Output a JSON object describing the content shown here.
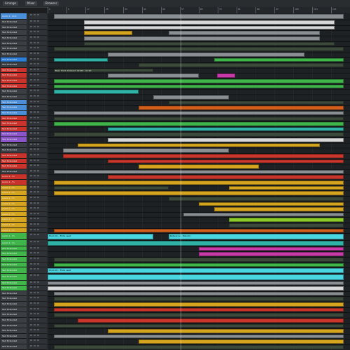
{
  "window": {
    "tabs": [
      "Arrange",
      "Mixer",
      "Browser"
    ]
  },
  "ruler": {
    "bars": [
      "1",
      "9",
      "17",
      "25",
      "33",
      "41",
      "49",
      "57",
      "65",
      "73",
      "81",
      "89",
      "97",
      "105",
      "113",
      "121"
    ]
  },
  "colors": {
    "green": "#3fb54a",
    "lime": "#8ccc2a",
    "yellow": "#d6a520",
    "orange": "#d2601c",
    "red": "#c8362c",
    "magenta": "#c83aa8",
    "purple": "#8a55c8",
    "teal": "#2fb3a6",
    "cyan": "#4ad6e0",
    "grey": "#8a8f94",
    "white": "#d8d8d8",
    "dark": "#3c4a3c"
  },
  "tracks": [
    {
      "name": "Audio 1 - Kick",
      "color": "#4b8fd8",
      "height": 6,
      "clips": [
        {
          "s": 0.02,
          "e": 0.98,
          "c": "grey",
          "l": ""
        }
      ]
    },
    {
      "name": "Text Extended",
      "color": "#3b3f44",
      "height": 5,
      "clips": [
        {
          "s": 0.12,
          "e": 0.95,
          "c": "white",
          "l": ""
        }
      ]
    },
    {
      "name": "Text Extended",
      "color": "#3b3f44",
      "height": 5,
      "clips": [
        {
          "s": 0.12,
          "e": 0.95,
          "c": "white",
          "l": ""
        }
      ]
    },
    {
      "name": "Text Extended",
      "color": "#3b3f44",
      "height": 5,
      "clips": [
        {
          "s": 0.12,
          "e": 0.28,
          "c": "yellow",
          "l": ""
        },
        {
          "s": 0.4,
          "e": 0.9,
          "c": "grey",
          "l": ""
        }
      ]
    },
    {
      "name": "Text Extended",
      "color": "#3b3f44",
      "height": 5,
      "clips": [
        {
          "s": 0.12,
          "e": 0.9,
          "c": "grey",
          "l": ""
        }
      ]
    },
    {
      "name": "Text Extended",
      "color": "#3b3f44",
      "height": 5,
      "clips": [
        {
          "s": 0.12,
          "e": 0.95,
          "c": "dark",
          "l": ""
        }
      ]
    },
    {
      "name": "Text Extended",
      "color": "#3b3f44",
      "height": 5,
      "clips": [
        {
          "s": 0.02,
          "e": 0.98,
          "c": "dark",
          "l": ""
        }
      ]
    },
    {
      "name": "Text Extended",
      "color": "#3b3f44",
      "height": 5,
      "clips": [
        {
          "s": 0.2,
          "e": 0.85,
          "c": "grey",
          "l": ""
        }
      ]
    },
    {
      "name": "Text Extended",
      "color": "#2c7ed6",
      "height": 5,
      "clips": [
        {
          "s": 0.02,
          "e": 0.2,
          "c": "teal",
          "l": ""
        },
        {
          "s": 0.55,
          "e": 0.98,
          "c": "green",
          "l": ""
        }
      ]
    },
    {
      "name": "Text Extended",
      "color": "#3b3f44",
      "height": 5,
      "clips": [
        {
          "s": 0.3,
          "e": 0.98,
          "c": "dark",
          "l": ""
        }
      ]
    },
    {
      "name": "Text Extended",
      "color": "#c9332b",
      "height": 5,
      "clips": [
        {
          "s": 0.02,
          "e": 0.35,
          "c": "dark",
          "l": "Bass_Hold_Ambient_A2016 - Kickit"
        }
      ]
    },
    {
      "name": "Text Extended",
      "color": "#c9332b",
      "height": 5,
      "clips": [
        {
          "s": 0.2,
          "e": 0.5,
          "c": "grey",
          "l": ""
        },
        {
          "s": 0.56,
          "e": 0.62,
          "c": "magenta",
          "l": ""
        }
      ]
    },
    {
      "name": "Text Extended",
      "color": "#c9332b",
      "height": 5,
      "clips": [
        {
          "s": 0.02,
          "e": 0.98,
          "c": "green",
          "l": ""
        }
      ]
    },
    {
      "name": "Text Extended",
      "color": "#c9332b",
      "height": 5,
      "clips": [
        {
          "s": 0.02,
          "e": 0.98,
          "c": "green",
          "l": ""
        }
      ]
    },
    {
      "name": "Text Extended",
      "color": "#3b3f44",
      "height": 5,
      "clips": [
        {
          "s": 0.02,
          "e": 0.3,
          "c": "teal",
          "l": ""
        }
      ]
    },
    {
      "name": "Text Extended",
      "color": "#3b3f44",
      "height": 5,
      "clips": [
        {
          "s": 0.35,
          "e": 0.6,
          "c": "grey",
          "l": ""
        }
      ]
    },
    {
      "name": "Text Extended",
      "color": "#4b8fd8",
      "height": 5,
      "clips": [
        {
          "s": 0.4,
          "e": 0.98,
          "c": "dark",
          "l": ""
        }
      ]
    },
    {
      "name": "Text Extended",
      "color": "#4b8fd8",
      "height": 5,
      "clips": [
        {
          "s": 0.3,
          "e": 0.98,
          "c": "orange",
          "l": ""
        }
      ]
    },
    {
      "name": "Text Extended",
      "color": "#4b8fd8",
      "height": 5,
      "clips": [
        {
          "s": 0.02,
          "e": 0.98,
          "c": "grey",
          "l": ""
        }
      ]
    },
    {
      "name": "Text Extended",
      "color": "#c9332b",
      "height": 5,
      "clips": [
        {
          "s": 0.02,
          "e": 0.98,
          "c": "dark",
          "l": ""
        }
      ]
    },
    {
      "name": "Text Extended",
      "color": "#c9332b",
      "height": 5,
      "clips": [
        {
          "s": 0.02,
          "e": 0.98,
          "c": "green",
          "l": ""
        }
      ]
    },
    {
      "name": "Text Extended",
      "color": "#c9332b",
      "height": 5,
      "clips": [
        {
          "s": 0.2,
          "e": 0.98,
          "c": "teal",
          "l": ""
        }
      ]
    },
    {
      "name": "Text Extended",
      "color": "#8a55c8",
      "height": 5,
      "clips": [
        {
          "s": 0.02,
          "e": 0.98,
          "c": "dark",
          "l": ""
        }
      ]
    },
    {
      "name": "Text Extended",
      "color": "#8a55c8",
      "height": 5,
      "clips": [
        {
          "s": 0.2,
          "e": 0.98,
          "c": "white",
          "l": ""
        }
      ]
    },
    {
      "name": "Text Extended",
      "color": "#3b3f44",
      "height": 5,
      "clips": [
        {
          "s": 0.1,
          "e": 0.9,
          "c": "yellow",
          "l": ""
        }
      ]
    },
    {
      "name": "Text Extended",
      "color": "#3b3f44",
      "height": 5,
      "clips": [
        {
          "s": 0.05,
          "e": 0.6,
          "c": "grey",
          "l": ""
        }
      ]
    },
    {
      "name": "Text Extended",
      "color": "#c9332b",
      "height": 5,
      "clips": [
        {
          "s": 0.05,
          "e": 0.98,
          "c": "red",
          "l": ""
        }
      ]
    },
    {
      "name": "Text Extended",
      "color": "#c9332b",
      "height": 5,
      "clips": [
        {
          "s": 0.2,
          "e": 0.98,
          "c": "red",
          "l": ""
        }
      ]
    },
    {
      "name": "Text Extended",
      "color": "#c9332b",
      "height": 5,
      "clips": [
        {
          "s": 0.3,
          "e": 0.7,
          "c": "yellow",
          "l": ""
        }
      ]
    },
    {
      "name": "Text Extended",
      "color": "#3b3f44",
      "height": 5,
      "clips": [
        {
          "s": 0.02,
          "e": 0.98,
          "c": "grey",
          "l": ""
        }
      ]
    },
    {
      "name": "Audio 1 - Fx",
      "color": "#c9332b",
      "height": 5,
      "clips": [
        {
          "s": 0.2,
          "e": 0.98,
          "c": "red",
          "l": ""
        }
      ]
    },
    {
      "name": "Audio 1 - Fx",
      "color": "#c9332b",
      "height": 5,
      "clips": [
        {
          "s": 0.02,
          "e": 0.98,
          "c": "yellow",
          "l": ""
        }
      ]
    },
    {
      "name": "Audio 1 - Fx",
      "color": "#d6a520",
      "height": 5,
      "clips": [
        {
          "s": 0.02,
          "e": 0.4,
          "c": "dark",
          "l": ""
        },
        {
          "s": 0.6,
          "e": 0.98,
          "c": "yellow",
          "l": ""
        }
      ]
    },
    {
      "name": "Audio 1 - Fx",
      "color": "#d6a520",
      "height": 5,
      "clips": [
        {
          "s": 0.02,
          "e": 0.98,
          "c": "yellow",
          "l": ""
        }
      ]
    },
    {
      "name": "Audio 1 - Fx",
      "color": "#d6a520",
      "height": 5,
      "clips": [
        {
          "s": 0.4,
          "e": 0.98,
          "c": "dark",
          "l": ""
        }
      ]
    },
    {
      "name": "Audio 1 - Fx",
      "color": "#d6a520",
      "height": 5,
      "clips": [
        {
          "s": 0.5,
          "e": 0.98,
          "c": "yellow",
          "l": ""
        }
      ]
    },
    {
      "name": "Audio 1 - Fx",
      "color": "#d6a520",
      "height": 5,
      "clips": [
        {
          "s": 0.55,
          "e": 0.98,
          "c": "yellow",
          "l": ""
        }
      ]
    },
    {
      "name": "Audio 1 - Fx",
      "color": "#d6a520",
      "height": 5,
      "clips": [
        {
          "s": 0.45,
          "e": 0.98,
          "c": "grey",
          "l": ""
        }
      ]
    },
    {
      "name": "Audio 1 - Fx",
      "color": "#d6a520",
      "height": 5,
      "clips": [
        {
          "s": 0.6,
          "e": 0.98,
          "c": "lime",
          "l": ""
        }
      ]
    },
    {
      "name": "Audio 1 - Fx",
      "color": "#d6a520",
      "height": 5,
      "clips": [
        {
          "s": 0.6,
          "e": 0.98,
          "c": "dark",
          "l": ""
        }
      ]
    },
    {
      "name": "Audio 1 - Fx",
      "color": "#d6a520",
      "height": 5,
      "clips": [
        {
          "s": 0.02,
          "e": 0.98,
          "c": "orange",
          "l": ""
        }
      ]
    },
    {
      "name": "Audio 1 - Fx",
      "color": "#3fb54a",
      "height": 6,
      "clips": [
        {
          "s": 0.0,
          "e": 0.35,
          "c": "cyan",
          "l": "Pluck 01 - Flute Lead"
        },
        {
          "s": 0.4,
          "e": 0.98,
          "c": "cyan",
          "l": "Reference - Melodic"
        }
      ]
    },
    {
      "name": "Audio 1 - Fx",
      "color": "#3fb54a",
      "height": 6,
      "clips": [
        {
          "s": 0.0,
          "e": 0.98,
          "c": "teal",
          "l": ""
        }
      ]
    },
    {
      "name": "Text Extended",
      "color": "#3fb54a",
      "height": 5,
      "clips": [
        {
          "s": 0.5,
          "e": 0.98,
          "c": "magenta",
          "l": ""
        }
      ]
    },
    {
      "name": "Text Extended",
      "color": "#3fb54a",
      "height": 5,
      "clips": [
        {
          "s": 0.5,
          "e": 0.98,
          "c": "magenta",
          "l": ""
        }
      ]
    },
    {
      "name": "Text Extended",
      "color": "#3fb54a",
      "height": 5,
      "clips": [
        {
          "s": 0.02,
          "e": 0.98,
          "c": "dark",
          "l": ""
        }
      ]
    },
    {
      "name": "Text Extended",
      "color": "#3fb54a",
      "height": 5,
      "clips": [
        {
          "s": 0.02,
          "e": 0.98,
          "c": "green",
          "l": ""
        }
      ]
    },
    {
      "name": "Text Extended",
      "color": "#3fb54a",
      "height": 6,
      "clips": [
        {
          "s": 0.0,
          "e": 0.98,
          "c": "cyan",
          "l": "Pluck 01 - Flute Lead"
        }
      ]
    },
    {
      "name": "Text Extended",
      "color": "#3fb54a",
      "height": 6,
      "clips": [
        {
          "s": 0.0,
          "e": 0.98,
          "c": "cyan",
          "l": ""
        }
      ]
    },
    {
      "name": "Text Extended",
      "color": "#3fb54a",
      "height": 5,
      "clips": [
        {
          "s": 0.0,
          "e": 0.98,
          "c": "grey",
          "l": ""
        }
      ]
    },
    {
      "name": "Text Extended",
      "color": "#3fb54a",
      "height": 5,
      "clips": [
        {
          "s": 0.0,
          "e": 0.98,
          "c": "white",
          "l": ""
        }
      ]
    },
    {
      "name": "Text Extended",
      "color": "#3b3f44",
      "height": 5,
      "clips": [
        {
          "s": 0.02,
          "e": 0.98,
          "c": "grey",
          "l": ""
        }
      ]
    },
    {
      "name": "Text Extended",
      "color": "#3b3f44",
      "height": 5,
      "clips": [
        {
          "s": 0.02,
          "e": 0.98,
          "c": "dark",
          "l": ""
        }
      ]
    },
    {
      "name": "Text Extended",
      "color": "#3b3f44",
      "height": 5,
      "clips": [
        {
          "s": 0.02,
          "e": 0.98,
          "c": "yellow",
          "l": ""
        }
      ]
    },
    {
      "name": "Text Extended",
      "color": "#3b3f44",
      "height": 5,
      "clips": [
        {
          "s": 0.02,
          "e": 0.98,
          "c": "red",
          "l": ""
        }
      ]
    },
    {
      "name": "Text Extended",
      "color": "#3b3f44",
      "height": 5,
      "clips": [
        {
          "s": 0.02,
          "e": 0.98,
          "c": "dark",
          "l": ""
        }
      ]
    },
    {
      "name": "Text Extended",
      "color": "#3b3f44",
      "height": 5,
      "clips": [
        {
          "s": 0.1,
          "e": 0.98,
          "c": "red",
          "l": ""
        }
      ]
    },
    {
      "name": "Text Extended",
      "color": "#3b3f44",
      "height": 5,
      "clips": [
        {
          "s": 0.02,
          "e": 0.98,
          "c": "dark",
          "l": ""
        }
      ]
    },
    {
      "name": "Text Extended",
      "color": "#3b3f44",
      "height": 5,
      "clips": [
        {
          "s": 0.2,
          "e": 0.98,
          "c": "yellow",
          "l": ""
        }
      ]
    },
    {
      "name": "Text Extended",
      "color": "#3b3f44",
      "height": 5,
      "clips": [
        {
          "s": 0.02,
          "e": 0.98,
          "c": "grey",
          "l": ""
        }
      ]
    },
    {
      "name": "Text Extended",
      "color": "#3b3f44",
      "height": 5,
      "clips": [
        {
          "s": 0.3,
          "e": 0.98,
          "c": "yellow",
          "l": ""
        }
      ]
    },
    {
      "name": "Text Extended",
      "color": "#3b3f44",
      "height": 5,
      "clips": [
        {
          "s": 0.02,
          "e": 0.98,
          "c": "dark",
          "l": ""
        }
      ]
    }
  ]
}
